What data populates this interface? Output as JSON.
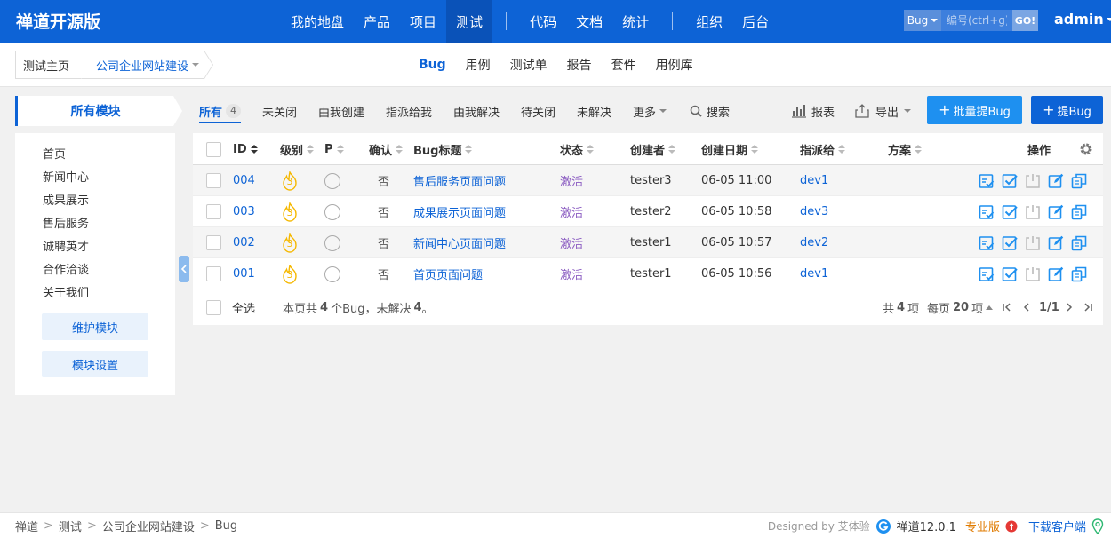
{
  "header": {
    "brand": "禅道开源版",
    "nav": [
      "我的地盘",
      "产品",
      "项目",
      "测试",
      "代码",
      "文档",
      "统计",
      "组织",
      "后台"
    ],
    "active_nav": "测试",
    "quick_search": {
      "type": "Bug",
      "placeholder": "编号(ctrl+g)",
      "go": "GO!"
    },
    "user": "admin"
  },
  "subheader": {
    "home": "测试主页",
    "project": "公司企业网站建设",
    "tabs": [
      "Bug",
      "用例",
      "测试单",
      "报告",
      "套件",
      "用例库"
    ],
    "active_tab": "Bug"
  },
  "sidebar": {
    "title": "所有模块",
    "modules": [
      "首页",
      "新闻中心",
      "成果展示",
      "售后服务",
      "诚聘英才",
      "合作洽谈",
      "关于我们"
    ],
    "manage_button": "维护模块",
    "settings_button": "模块设置"
  },
  "featurebar": {
    "tabs": [
      {
        "label": "所有",
        "count": "4"
      },
      {
        "label": "未关闭"
      },
      {
        "label": "由我创建"
      },
      {
        "label": "指派给我"
      },
      {
        "label": "由我解决"
      },
      {
        "label": "待关闭"
      },
      {
        "label": "未解决"
      },
      {
        "label": "更多"
      }
    ],
    "search": "搜索",
    "report": "报表",
    "export": "导出",
    "batch_create": "批量提Bug",
    "create": "提Bug"
  },
  "table": {
    "headers": {
      "id": "ID",
      "severity": "级别",
      "pri": "P",
      "confirm": "确认",
      "title": "Bug标题",
      "status": "状态",
      "creator": "创建者",
      "date": "创建日期",
      "assigned": "指派给",
      "resolution": "方案",
      "actions": "操作"
    },
    "rows": [
      {
        "id": "004",
        "severity": "3",
        "confirmed": "否",
        "title": "售后服务页面问题",
        "status": "激活",
        "creator": "tester3",
        "date": "06-05 11:00",
        "assigned": "dev1"
      },
      {
        "id": "003",
        "severity": "3",
        "confirmed": "否",
        "title": "成果展示页面问题",
        "status": "激活",
        "creator": "tester2",
        "date": "06-05 10:58",
        "assigned": "dev3"
      },
      {
        "id": "002",
        "severity": "3",
        "confirmed": "否",
        "title": "新闻中心页面问题",
        "status": "激活",
        "creator": "tester1",
        "date": "06-05 10:57",
        "assigned": "dev2"
      },
      {
        "id": "001",
        "severity": "3",
        "confirmed": "否",
        "title": "首页页面问题",
        "status": "激活",
        "creator": "tester1",
        "date": "06-05 10:56",
        "assigned": "dev1"
      }
    ],
    "footer": {
      "select_all": "全选",
      "summary_prefix": "本页共",
      "summary_count": "4",
      "summary_mid": "个Bug，未解决",
      "summary_unresolved": "4",
      "summary_suffix": "。",
      "total_prefix": "共",
      "total": "4",
      "total_suffix": "项",
      "per_page_prefix": "每页",
      "per_page": "20",
      "per_page_suffix": "项",
      "page": "1/1"
    }
  },
  "footer": {
    "crumbs": [
      "禅道",
      "测试",
      "公司企业网站建设",
      "Bug"
    ],
    "designed_by": "Designed by 艾体验",
    "version": "禅道12.0.1",
    "pro": "专业版",
    "client": "下载客户端"
  },
  "colors": {
    "primary": "#0d63d6",
    "accent_button": "#1e90f0",
    "status": "#8a5bc1",
    "severity": "#f5b800"
  }
}
